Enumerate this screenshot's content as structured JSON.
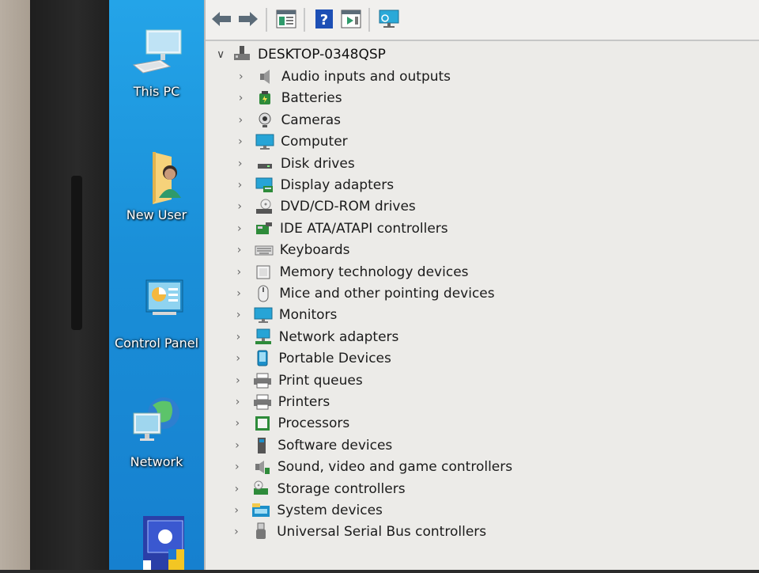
{
  "desktop": {
    "icons": [
      {
        "label": "This PC",
        "icon": "computer-icon"
      },
      {
        "label": "New User",
        "icon": "user-folder-icon"
      },
      {
        "label": "Control Panel",
        "icon": "control-panel-icon"
      },
      {
        "label": "Network",
        "icon": "network-icon"
      },
      {
        "label": "",
        "icon": "app-shortcut-icon"
      }
    ]
  },
  "toolbar": {
    "buttons": [
      "back-arrow-icon",
      "forward-arrow-icon",
      "properties-icon",
      "help-icon",
      "action-pane-icon",
      "monitor-scan-icon"
    ]
  },
  "tree": {
    "root": "DESKTOP-0348QSP",
    "categories": [
      {
        "label": "Audio inputs and outputs",
        "icon": "speaker-icon"
      },
      {
        "label": "Batteries",
        "icon": "battery-icon"
      },
      {
        "label": "Cameras",
        "icon": "camera-icon"
      },
      {
        "label": "Computer",
        "icon": "monitor-icon"
      },
      {
        "label": "Disk drives",
        "icon": "disk-drive-icon"
      },
      {
        "label": "Display adapters",
        "icon": "display-adapter-icon"
      },
      {
        "label": "DVD/CD-ROM drives",
        "icon": "dvd-drive-icon"
      },
      {
        "label": "IDE ATA/ATAPI controllers",
        "icon": "ide-controller-icon"
      },
      {
        "label": "Keyboards",
        "icon": "keyboard-icon"
      },
      {
        "label": "Memory technology devices",
        "icon": "memory-icon"
      },
      {
        "label": "Mice and other pointing devices",
        "icon": "mouse-icon"
      },
      {
        "label": "Monitors",
        "icon": "monitor-icon"
      },
      {
        "label": "Network adapters",
        "icon": "network-adapter-icon"
      },
      {
        "label": "Portable Devices",
        "icon": "portable-device-icon"
      },
      {
        "label": "Print queues",
        "icon": "printer-icon"
      },
      {
        "label": "Printers",
        "icon": "printer-icon"
      },
      {
        "label": "Processors",
        "icon": "processor-icon"
      },
      {
        "label": "Software devices",
        "icon": "software-device-icon"
      },
      {
        "label": "Sound, video and game controllers",
        "icon": "sound-controller-icon"
      },
      {
        "label": "Storage controllers",
        "icon": "storage-controller-icon"
      },
      {
        "label": "System devices",
        "icon": "system-devices-icon"
      },
      {
        "label": "Universal Serial Bus controllers",
        "icon": "usb-icon"
      }
    ]
  },
  "colors": {
    "desktop_blue": "#1a8fd8",
    "window_bg": "#ecebe8",
    "accent": "#1c8fc9"
  }
}
